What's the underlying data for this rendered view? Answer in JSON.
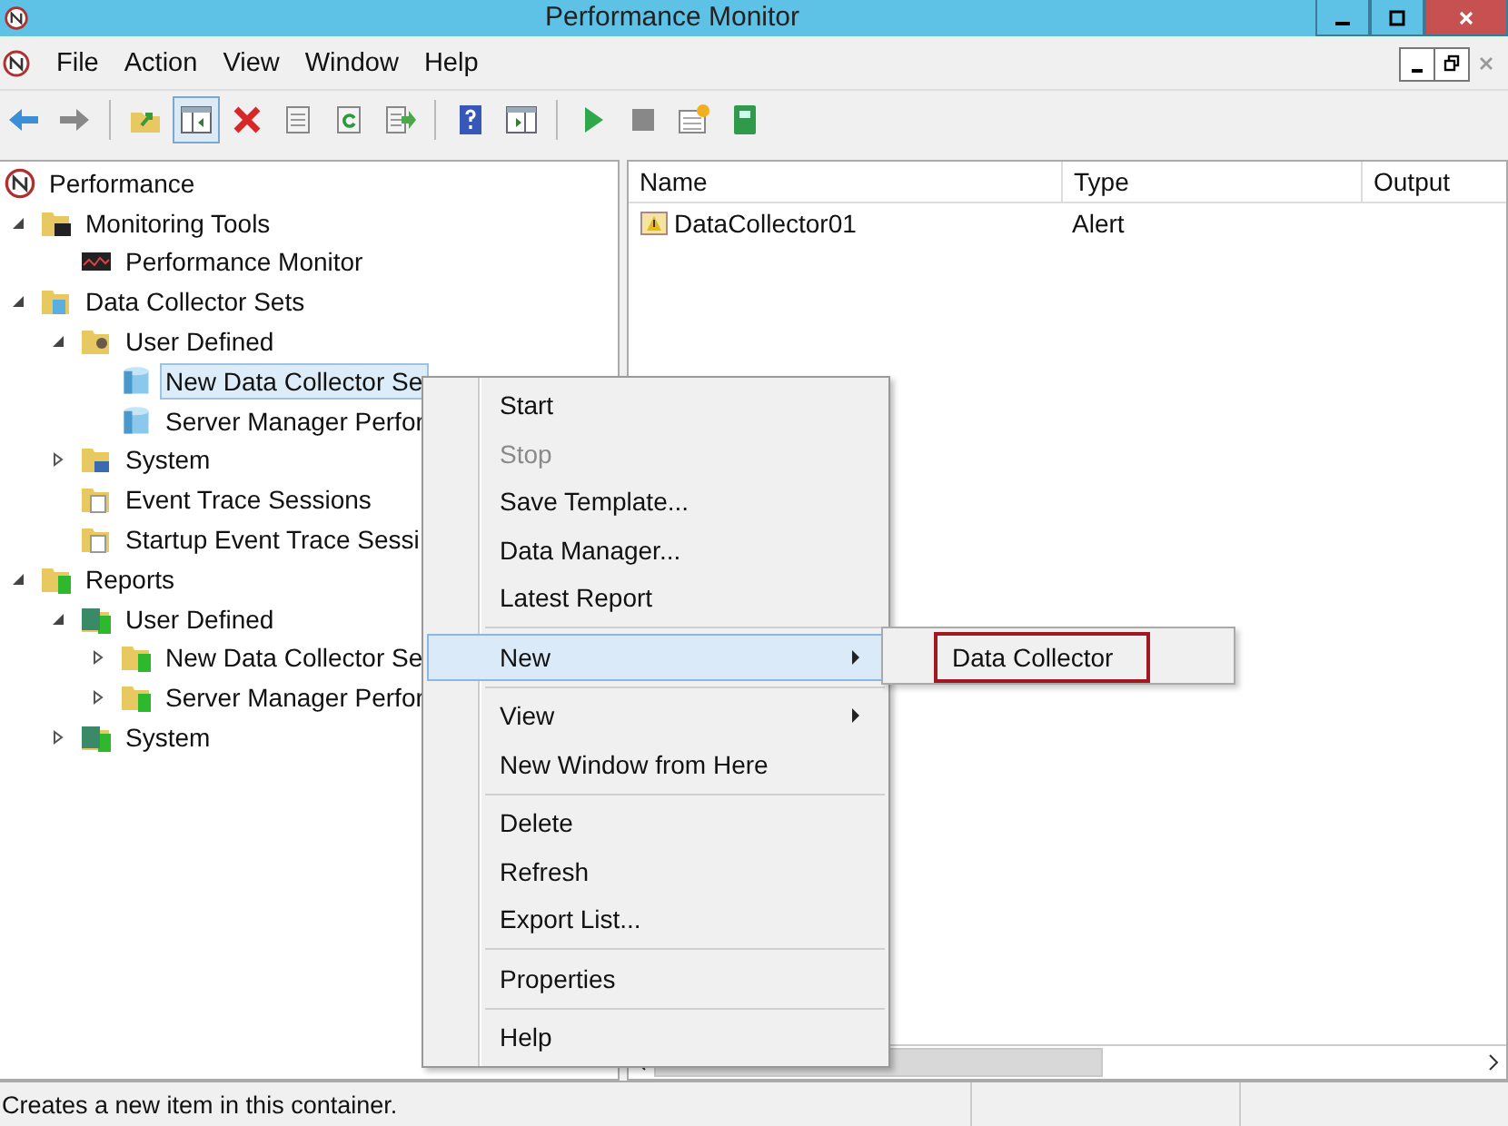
{
  "window": {
    "title": "Performance Monitor"
  },
  "menu_bar": [
    "File",
    "Action",
    "View",
    "Window",
    "Help"
  ],
  "toolbar": [
    [
      {
        "kind": "back",
        "pressed": false
      },
      {
        "kind": "forward",
        "pressed": false
      }
    ],
    [
      {
        "kind": "up",
        "pressed": false
      },
      {
        "kind": "tree",
        "pressed": true
      },
      {
        "kind": "delete",
        "pressed": false
      },
      {
        "kind": "properties",
        "pressed": false
      },
      {
        "kind": "refresh",
        "pressed": false
      },
      {
        "kind": "export",
        "pressed": false
      }
    ],
    [
      {
        "kind": "help",
        "pressed": false
      },
      {
        "kind": "panel",
        "pressed": false
      }
    ],
    [
      {
        "kind": "play",
        "pressed": false
      },
      {
        "kind": "stop",
        "pressed": false
      },
      {
        "kind": "new",
        "pressed": false
      },
      {
        "kind": "book",
        "pressed": false
      }
    ]
  ],
  "tree": [
    {
      "label": "Performance",
      "kind": "app",
      "selected": false,
      "children": [
        {
          "label": "Monitoring Tools",
          "kind": "tools",
          "expanded": true,
          "selected": false,
          "children": [
            {
              "label": "Performance Monitor",
              "kind": "chart",
              "selected": false
            }
          ]
        },
        {
          "label": "Data Collector Sets",
          "kind": "sets",
          "expanded": true,
          "selected": false,
          "children": [
            {
              "label": "User Defined",
              "kind": "user",
              "expanded": true,
              "selected": false,
              "children": [
                {
                  "label": "New Data Collector Se",
                  "kind": "set",
                  "selected": true
                },
                {
                  "label": "Server Manager Perfor",
                  "kind": "set",
                  "selected": false
                }
              ]
            },
            {
              "label": "System",
              "kind": "system",
              "expanded": false,
              "selected": false
            },
            {
              "label": "Event Trace Sessions",
              "kind": "trace",
              "selected": false
            },
            {
              "label": "Startup Event Trace Sessi",
              "kind": "trace",
              "selected": false
            }
          ]
        },
        {
          "label": "Reports",
          "kind": "report",
          "expanded": true,
          "selected": false,
          "children": [
            {
              "label": "User Defined",
              "kind": "report-user",
              "expanded": true,
              "selected": false,
              "children": [
                {
                  "label": "New Data Collector Se",
                  "kind": "report",
                  "expanded": false,
                  "selected": false
                },
                {
                  "label": "Server Manager Perfor",
                  "kind": "report",
                  "expanded": false,
                  "selected": false
                }
              ]
            },
            {
              "label": "System",
              "kind": "report-system",
              "expanded": false,
              "selected": false
            }
          ]
        }
      ]
    }
  ],
  "list": {
    "columns": [
      "Name",
      "Type",
      "Output"
    ],
    "rows": [
      {
        "cells": [
          "DataCollector01",
          "Alert"
        ],
        "kind": "alert"
      }
    ]
  },
  "context_menu": [
    [
      {
        "label": "Start",
        "disabled": false,
        "selected": false
      },
      {
        "label": "Stop",
        "disabled": true,
        "selected": false
      },
      {
        "label": "Save Template...",
        "disabled": false,
        "selected": false
      },
      {
        "label": "Data Manager...",
        "disabled": false,
        "selected": false
      },
      {
        "label": "Latest Report",
        "disabled": false,
        "selected": false
      }
    ],
    [
      {
        "label": "New",
        "disabled": false,
        "selected": true,
        "submenu": true
      }
    ],
    [
      {
        "label": "View",
        "disabled": false,
        "selected": false,
        "submenu": true
      },
      {
        "label": "New Window from Here",
        "disabled": false,
        "selected": false
      }
    ],
    [
      {
        "label": "Delete",
        "disabled": false,
        "selected": false
      },
      {
        "label": "Refresh",
        "disabled": false,
        "selected": false
      },
      {
        "label": "Export List...",
        "disabled": false,
        "selected": false
      }
    ],
    [
      {
        "label": "Properties",
        "disabled": false,
        "selected": false
      }
    ],
    [
      {
        "label": "Help",
        "disabled": false,
        "selected": false
      }
    ]
  ],
  "submenu": [
    {
      "label": "Data Collector",
      "marked": true
    }
  ],
  "status_bar": {
    "text": "Creates a new item in this container."
  }
}
